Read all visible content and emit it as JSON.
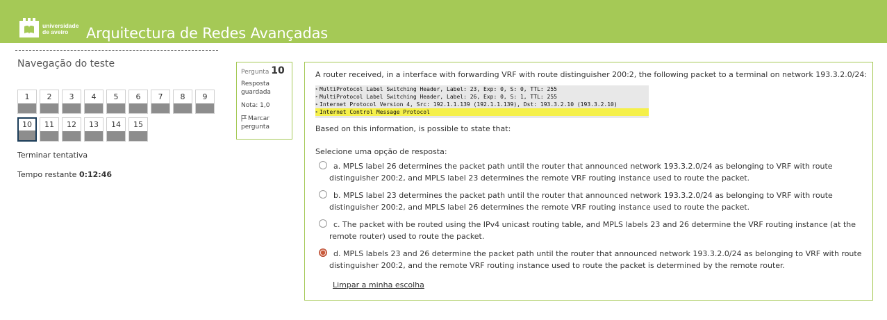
{
  "header": {
    "logo_icon": "university-logo-icon",
    "logo_line1": "universidade",
    "logo_line2": "de aveiro",
    "site_title": "Arquitectura de Redes Avançadas",
    "bg_color": "#a5c956"
  },
  "nav": {
    "title": "Navegação do teste",
    "questions": [
      "1",
      "2",
      "3",
      "4",
      "5",
      "6",
      "7",
      "8",
      "9",
      "10",
      "11",
      "12",
      "13",
      "14",
      "15"
    ],
    "current": "10",
    "finish_link": "Terminar tentativa",
    "time_label": "Tempo restante",
    "time_value": "0:12:46"
  },
  "question_info": {
    "label": "Pergunta",
    "number": "10",
    "status_line1": "Resposta",
    "status_line2": "guardada",
    "grade": "Nota: 1,0",
    "flag_icon": "flag-icon",
    "flag_line1": "Marcar",
    "flag_line2": "pergunta"
  },
  "question": {
    "text": "A router received, in a interface with forwarding VRF with route distinguisher 200:2, the following packet to a terminal on network 193.3.2.0/24:",
    "packet_lines": [
      "MultiProtocol Label Switching Header, Label: 23, Exp: 0, S: 0, TTL: 255",
      "MultiProtocol Label Switching Header, Label: 26, Exp: 0, S: 1, TTL: 255",
      "Internet Protocol Version 4, Src: 192.1.1.139 (192.1.1.139), Dst: 193.3.2.10 (193.3.2.10)",
      "Internet Control Message Protocol"
    ],
    "highlight_color": "#f5f04a",
    "based_on": "Based on this information, is possible to state that:",
    "prompt": "Selecione uma opção de resposta:",
    "answers": [
      {
        "text": "a. MPLS label 26 determines the packet path until the router that announced network 193.3.2.0/24 as belonging to VRF with route distinguisher 200:2, and MPLS label 23 determines the remote VRF routing instance used to route the packet.",
        "selected": false
      },
      {
        "text": "b. MPLS label 23 determines the packet path until the router that announced network 193.3.2.0/24 as belonging to VRF with route distinguisher 200:2, and MPLS label 26 determines the remote VRF routing instance used to route the packet.",
        "selected": false
      },
      {
        "text": "c. The packet with be routed using the IPv4 unicast routing table, and MPLS labels 23 and 26 determine the VRF routing instance (at the remote router) used to route the packet.",
        "selected": false
      },
      {
        "text": "d. MPLS labels 23 and 26 determine the packet path until the router that announced network 193.3.2.0/24 as belonging to VRF with route distinguisher 200:2, and the remote VRF routing instance used to route the packet is determined by the remote router.",
        "selected": true
      }
    ],
    "clear_choice": "Limpar a minha escolha"
  }
}
